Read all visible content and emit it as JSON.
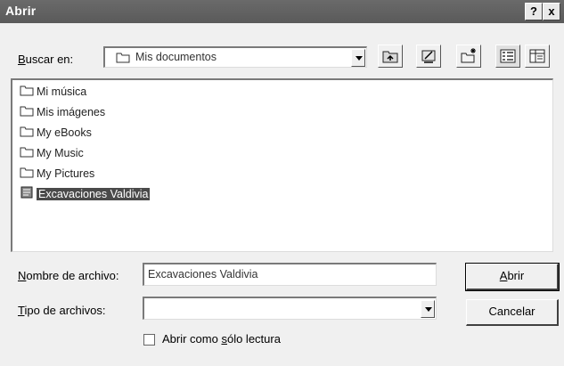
{
  "window": {
    "title": "Abrir",
    "help_btn": "?",
    "close_btn": "x"
  },
  "lookin": {
    "label_u": "B",
    "label_rest": "uscar en:",
    "value": "Mis documentos"
  },
  "toolbar": {
    "icons": [
      "up-folder-icon",
      "desktop-icon",
      "new-folder-icon",
      "list-view-icon",
      "details-view-icon"
    ]
  },
  "files": [
    {
      "name": "Mi música",
      "type": "folder"
    },
    {
      "name": "Mis imágenes",
      "type": "folder"
    },
    {
      "name": "My eBooks",
      "type": "folder"
    },
    {
      "name": "My Music",
      "type": "folder"
    },
    {
      "name": "My Pictures",
      "type": "folder"
    },
    {
      "name": "Excavaciones Valdivia",
      "type": "document",
      "selected": true
    }
  ],
  "filename": {
    "label_u": "N",
    "label_rest": "ombre de archivo:",
    "value": "Excavaciones Valdivia"
  },
  "filetype": {
    "label_u": "T",
    "label_rest": "ipo de archivos:",
    "value": ""
  },
  "buttons": {
    "open_u": "A",
    "open_rest": "brir",
    "cancel": "Cancelar"
  },
  "readonly": {
    "pre": "Abrir como ",
    "u": "s",
    "post": "ólo lectura"
  }
}
